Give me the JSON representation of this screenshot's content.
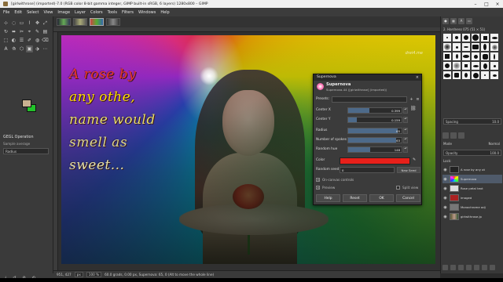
{
  "window": {
    "title": "[girlwithrose] (imported)-7.0 (RGB color 8-bit gamma integer, GIMP built-in sRGB, 6 layers) 1280x800 – GIMP",
    "controls": [
      "–",
      "□",
      "×"
    ]
  },
  "menubar": [
    "File",
    "Edit",
    "Select",
    "View",
    "Image",
    "Layer",
    "Colors",
    "Tools",
    "Filters",
    "Windows",
    "Help"
  ],
  "toolbox": {
    "tools": [
      "⊹",
      "◌",
      "▭",
      "⌇",
      "✥",
      "⤢",
      "↻",
      "⬌",
      "✂",
      "⌖",
      "✎",
      "▤",
      "⬚",
      "◐",
      "☰",
      "✐",
      "◍",
      "⌫",
      "A",
      "⟰",
      "⬡",
      "▣",
      "⬗",
      "⋯"
    ],
    "options_title": "GEGL Operation",
    "options_row": "Sample average",
    "options_select": "Radius"
  },
  "canvas": {
    "poem": [
      "A rose by",
      "any othe,",
      "name would",
      "smell as",
      "sweet..."
    ],
    "watermark": "drei4.me"
  },
  "dialog": {
    "window_title": "Supernova",
    "name": "Supernova",
    "subtitle": "Supernova-44 ([girlwithrose] (imported))",
    "presets_label": "Presets:",
    "center_x": {
      "label": "Center X",
      "value": "0.399",
      "fraction": 0.399
    },
    "center_y": {
      "label": "Center Y",
      "value": "0.159",
      "fraction": 0.159
    },
    "radius": {
      "label": "Radius",
      "value": "65",
      "fraction": 0.93
    },
    "spokes": {
      "label": "Number of spokes",
      "value": "63",
      "fraction": 0.9
    },
    "hue": {
      "label": "Random hue",
      "value": "148",
      "fraction": 0.41
    },
    "color_label": "Color",
    "color_value": "#e8201a",
    "seed_label": "Random seed",
    "seed_value": "0",
    "new_seed": "New Seed",
    "on_canvas": "On-canvas controls",
    "preview": "Preview",
    "split_view": "Split view",
    "buttons": [
      "Help",
      "Reset",
      "OK",
      "Cancel"
    ]
  },
  "dock": {
    "brush_title": "2. Hardness 075 (51 × 51)",
    "spacing_label": "Spacing",
    "spacing_value": "10.0",
    "mode_label": "Mode",
    "mode_value": "Normal",
    "opacity_label": "Opacity",
    "opacity_value": "100.0",
    "lock_label": "Lock:",
    "layers": [
      {
        "name": "A rose by any ot",
        "selected": false
      },
      {
        "name": "Supernova",
        "selected": true
      },
      {
        "name": "Rose petal text",
        "selected": false
      },
      {
        "name": "imaged",
        "selected": false
      },
      {
        "name": "Monochrome adj",
        "selected": false
      },
      {
        "name": "girlwithrose.jp",
        "selected": false
      }
    ]
  },
  "status": {
    "coords": "951, 427",
    "unit": "px",
    "zoom": "100 %",
    "message": "60.0 grads, 0.00 px, Supernova: 65, 0 (Alt to move the whole line)"
  },
  "colors": {
    "fg": "#c8b090",
    "bg": "#22c22a",
    "accent": "#4f5a6a"
  }
}
